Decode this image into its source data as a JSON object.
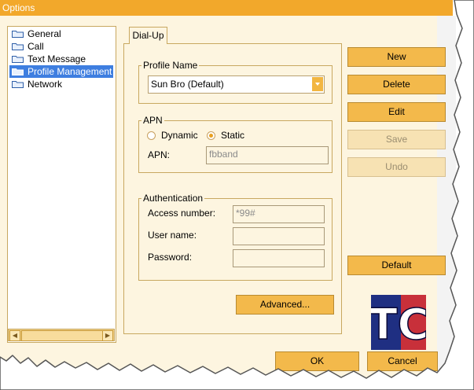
{
  "window": {
    "title": "Options"
  },
  "tree": {
    "items": [
      {
        "label": "General",
        "selected": false
      },
      {
        "label": "Call",
        "selected": false
      },
      {
        "label": "Text Message",
        "selected": false
      },
      {
        "label": "Profile Management",
        "selected": true
      },
      {
        "label": "Network",
        "selected": false
      }
    ]
  },
  "tabs": {
    "active": "Dial-Up"
  },
  "profile": {
    "legend": "Profile Name",
    "selected": "Sun Bro (Default)"
  },
  "apn": {
    "legend": "APN",
    "dynamic_label": "Dynamic",
    "static_label": "Static",
    "selected_mode": "Static",
    "apn_label": "APN:",
    "apn_value": "fbband"
  },
  "auth": {
    "legend": "Authentication",
    "access_label": "Access number:",
    "access_value": "*99#",
    "user_label": "User name:",
    "user_value": "",
    "password_label": "Password:",
    "password_value": ""
  },
  "buttons": {
    "advanced": "Advanced...",
    "new": "New",
    "delete": "Delete",
    "edit": "Edit",
    "save": "Save",
    "undo": "Undo",
    "default": "Default",
    "ok": "OK",
    "cancel": "Cancel"
  },
  "logo": {
    "text": "TC"
  },
  "colors": {
    "accent": "#f2a82b",
    "button": "#f3b94b",
    "selection": "#3e7ee0"
  }
}
